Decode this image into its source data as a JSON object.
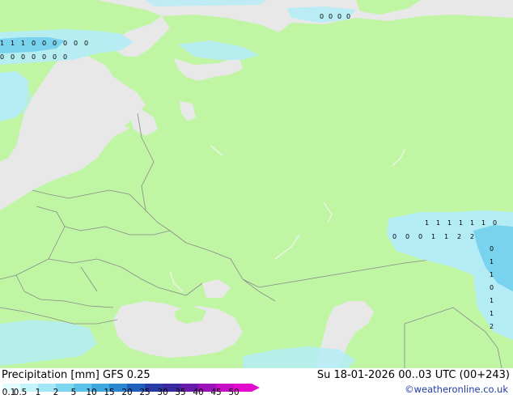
{
  "map": {
    "land_color": "#c0f5a4",
    "sea_color": "#e8e8e8",
    "border_color": "#8a8a8a",
    "precip_light_color": "#b4ecf6",
    "precip_mid_color": "#7ad3ee",
    "cell_values": {
      "north_sea_row": "1 1 1 0 0 0 0 0 0",
      "nw_row2": "0 0 0 0 0 0 0",
      "barents_row": "0 0 0 0",
      "east_row1": "1 1 1 1 1 1 0",
      "east_row2": "0 0 0 1 1 2 2",
      "east_col": "0 1 1 0 1 1 2"
    }
  },
  "footer": {
    "title_left": "Precipitation [mm] GFS 0.25",
    "title_right": "Su 18-01-2026 00..03 UTC (00+243)",
    "credit": "©weatheronline.co.uk"
  },
  "legend": {
    "ticks": [
      "0.1",
      "0.5",
      "1",
      "2",
      "5",
      "10",
      "15",
      "20",
      "25",
      "30",
      "35",
      "40",
      "45",
      "50"
    ],
    "colors": [
      "#e4fbff",
      "#c3f3fb",
      "#a1e7f6",
      "#7dd6f0",
      "#5cc2ea",
      "#3da8e0",
      "#2c86d0",
      "#1f5fbe",
      "#2a3aa9",
      "#3a28a0",
      "#6a1aaa",
      "#9a12b8",
      "#c80ec4",
      "#e40ccc"
    ]
  }
}
